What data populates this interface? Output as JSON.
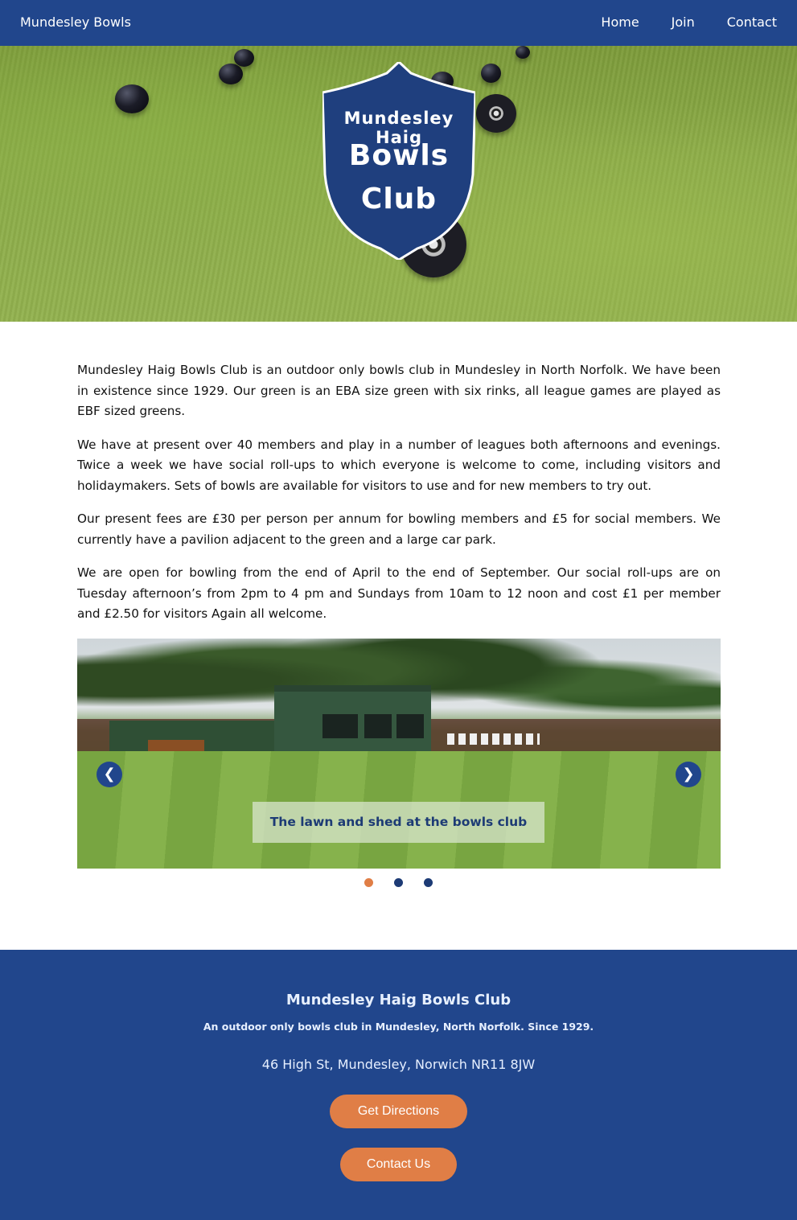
{
  "nav": {
    "brand": "Mundesley Bowls",
    "links": [
      "Home",
      "Join",
      "Contact"
    ]
  },
  "hero": {
    "crest_line1": "Mundesley Haig",
    "crest_line2": "Bowls",
    "crest_line3": "Club"
  },
  "content": {
    "paragraphs": [
      "Mundesley Haig Bowls Club is an outdoor only bowls club in Mundesley in North Norfolk. We have been in existence since 1929. Our green is an EBA size green with six rinks, all league games are played as EBF sized greens.",
      "We have at present over 40 members and play in a number of leagues both afternoons and evenings. Twice a week we have social roll-ups to which everyone is welcome to come, including visitors and holidaymakers. Sets of bowls are available for visitors to use and for new members to try out.",
      "Our present fees are £30 per person per annum for bowling members and £5 for social members. We currently have a pavilion adjacent to the green and a large car park.",
      "We are open for bowling from the end of April to the end of September. Our social roll-ups are on Tuesday afternoon’s from 2pm to 4 pm and Sundays from 10am to 12 noon and cost £1 per member and £2.50 for visitors Again all welcome."
    ]
  },
  "carousel": {
    "caption": "The lawn and shed at the bowls club",
    "prev_symbol": "❮",
    "next_symbol": "❯",
    "slide_count": 3,
    "active_index": 0
  },
  "footer": {
    "title": "Mundesley Haig Bowls Club",
    "subtitle": "An outdoor only bowls club in Mundesley, North Norfolk. Since 1929.",
    "address": "46 High St, Mundesley, Norwich NR11 8JW",
    "directions_label": "Get Directions",
    "contact_label": "Contact Us"
  },
  "colors": {
    "primary": "#21468c",
    "accent": "#e07e46",
    "dot_active": "#e07e46",
    "dot_inactive": "#1d3b75"
  }
}
